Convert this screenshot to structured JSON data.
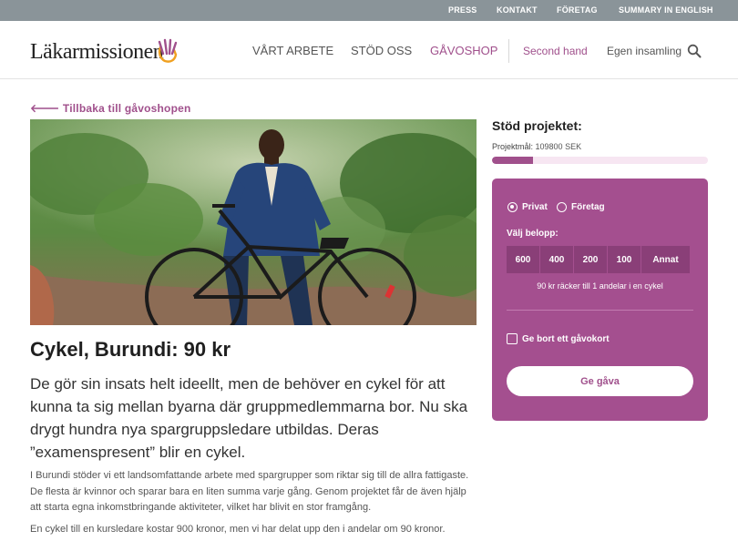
{
  "topbar": {
    "links": [
      "PRESS",
      "KONTAKT",
      "FÖRETAG",
      "SUMMARY IN ENGLISH"
    ]
  },
  "header": {
    "logo_text": "Läkarmissionen",
    "nav": {
      "arbete": "VÅRT ARBETE",
      "stod": "STÖD OSS",
      "shop": "GÅVOSHOP",
      "second_hand": "Second hand",
      "insamling": "Egen insamling"
    },
    "search_icon": "search-icon"
  },
  "back_link": "🡐 Tillbaka till gåvoshopen",
  "product": {
    "title": "Cykel, Burundi: 90 kr",
    "lead": "De gör sin insats helt ideellt, men de behöver en cykel för att kunna ta sig mellan byarna där gruppmedlemmarna bor. Nu ska drygt hundra nya spargruppsledare utbildas. Deras ”examenspresent” blir en cykel.",
    "body1": "I Burundi stöder vi ett landsomfattande arbete med spargrupper som riktar sig till de allra fattigaste. De flesta är kvinnor och sparar bara en liten summa varje gång. Genom projektet får de även hjälp att starta egna inkomstbringande aktiviteter, vilket har blivit en stor framgång.",
    "body2": "En cykel till en kursledare kostar 900 kronor, men vi har delat upp den i andelar om 90 kronor."
  },
  "support": {
    "title": "Stöd projektet:",
    "goal_label": "Projektmål:",
    "goal_value": "109800 SEK",
    "progress_fraction": 0.19,
    "accent_color": "#a0508c",
    "panel_color": "#a44f8f"
  },
  "donate": {
    "radio_private": "Privat",
    "radio_company": "Företag",
    "amount_label": "Välj belopp:",
    "amounts": [
      "600",
      "400",
      "200",
      "100",
      "Annat"
    ],
    "info": "90 kr räcker till 1 andelar i en cykel",
    "gift_card": "Ge bort ett gåvokort",
    "give_button": "Ge gåva"
  }
}
